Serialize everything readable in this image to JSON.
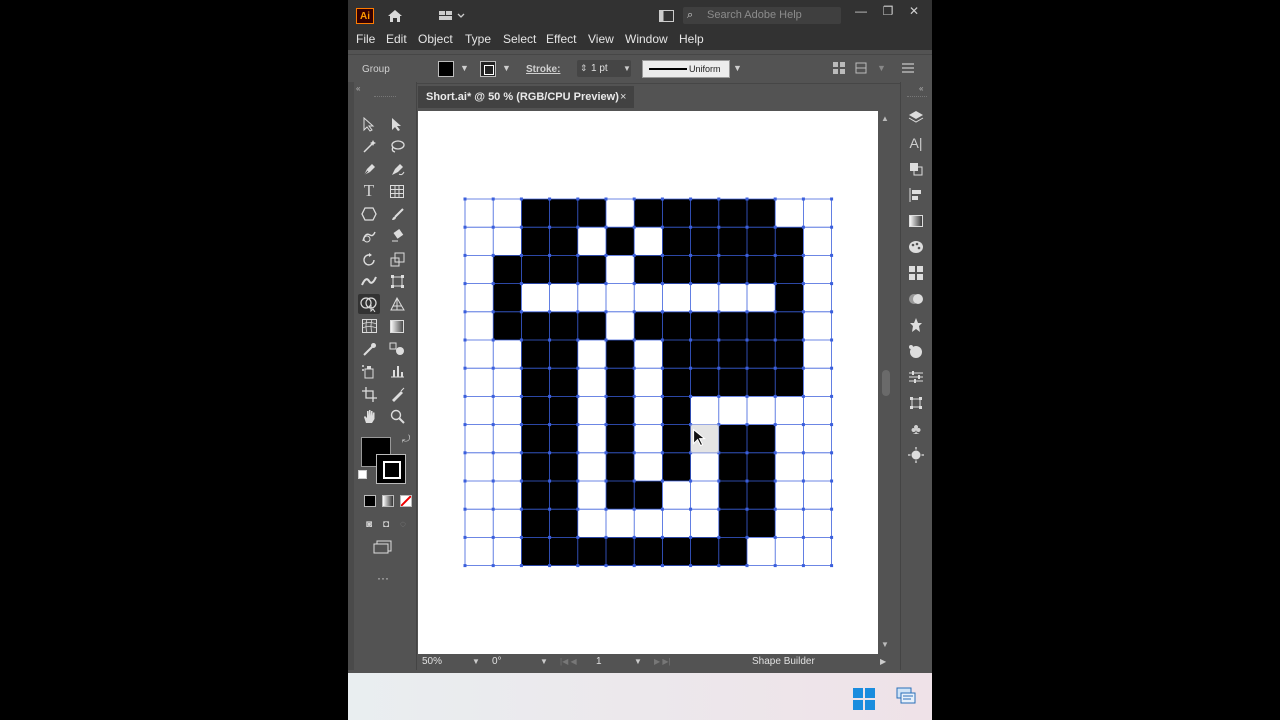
{
  "app": {
    "logo_text": "Ai",
    "search_placeholder": "Search Adobe Help",
    "window_controls": [
      "—",
      "❐",
      "✕"
    ]
  },
  "menu": [
    "File",
    "Edit",
    "Object",
    "Type",
    "Select",
    "Effect",
    "View",
    "Window",
    "Help"
  ],
  "control_bar": {
    "selection_label": "Group",
    "stroke_label": "Stroke:",
    "stroke_weight": "1 pt",
    "profile_label": "Uniform"
  },
  "document_tab": {
    "title": "Short.ai* @ 50 % (RGB/CPU Preview)",
    "close": "×"
  },
  "status_bar": {
    "zoom": "50%",
    "rotation": "0°",
    "artboard_number": "1",
    "current_tool": "Shape Builder"
  },
  "colors": {
    "ui_dark": "#323232",
    "ui_mid": "#535353",
    "selection_blue": "#3b5fdc",
    "fill": "#000000"
  },
  "artwork": {
    "grid_columns": 13,
    "grid_rows": 13,
    "black_rows": [
      "..111.11111..",
      "..11.1.11111.",
      ".1111.111111.",
      ".1.........1.",
      ".1111.111111.",
      "..11.1.11111.",
      "..11.1.11111.",
      "..11.1.1.....",
      "..11.1.1.11..",
      "..11.1.1.11..",
      "..11.11..11..",
      "..11.....11..",
      "..11111111..."
    ],
    "cursor": "shape-builder-cursor"
  }
}
